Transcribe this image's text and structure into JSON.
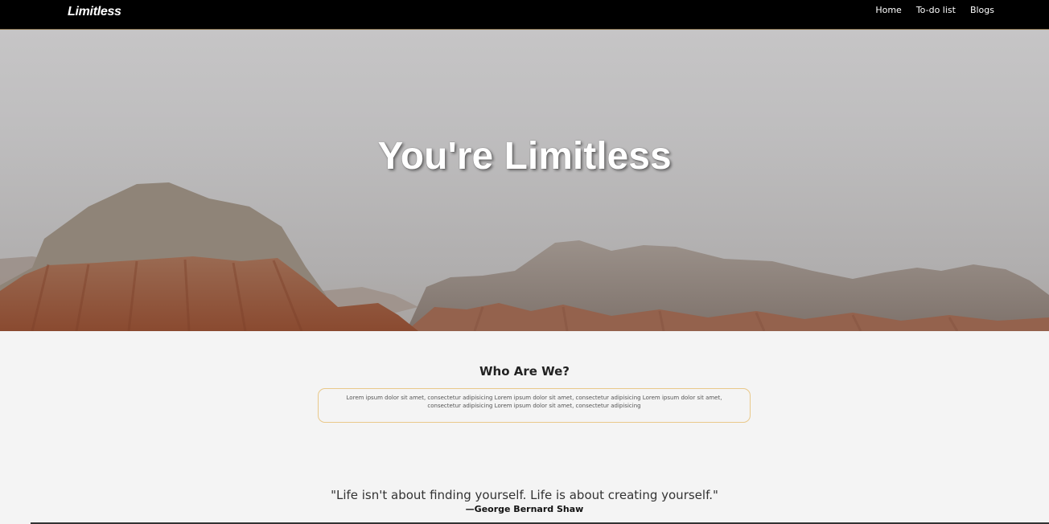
{
  "header": {
    "brand": "Limitless",
    "nav": [
      "Home",
      "To-do list",
      "Blogs"
    ]
  },
  "hero": {
    "title": "You're Limitless"
  },
  "about": {
    "title": "Who Are We?",
    "text": "Lorem ipsum dolor sit amet, consectetur adipisicing Lorem ipsum dolor sit amet, consectetur adipisicing Lorem ipsum dolor sit amet, consectetur adipisicing Lorem ipsum dolor sit amet, consectetur adipisicing"
  },
  "quote": {
    "text": "\"Life isn't about finding yourself. Life is about creating yourself.\"",
    "author": "—George Bernard Shaw"
  },
  "colors": {
    "header_bg": "#000000",
    "accent_border": "#e9c88a",
    "page_bg": "#f4f4f4"
  }
}
